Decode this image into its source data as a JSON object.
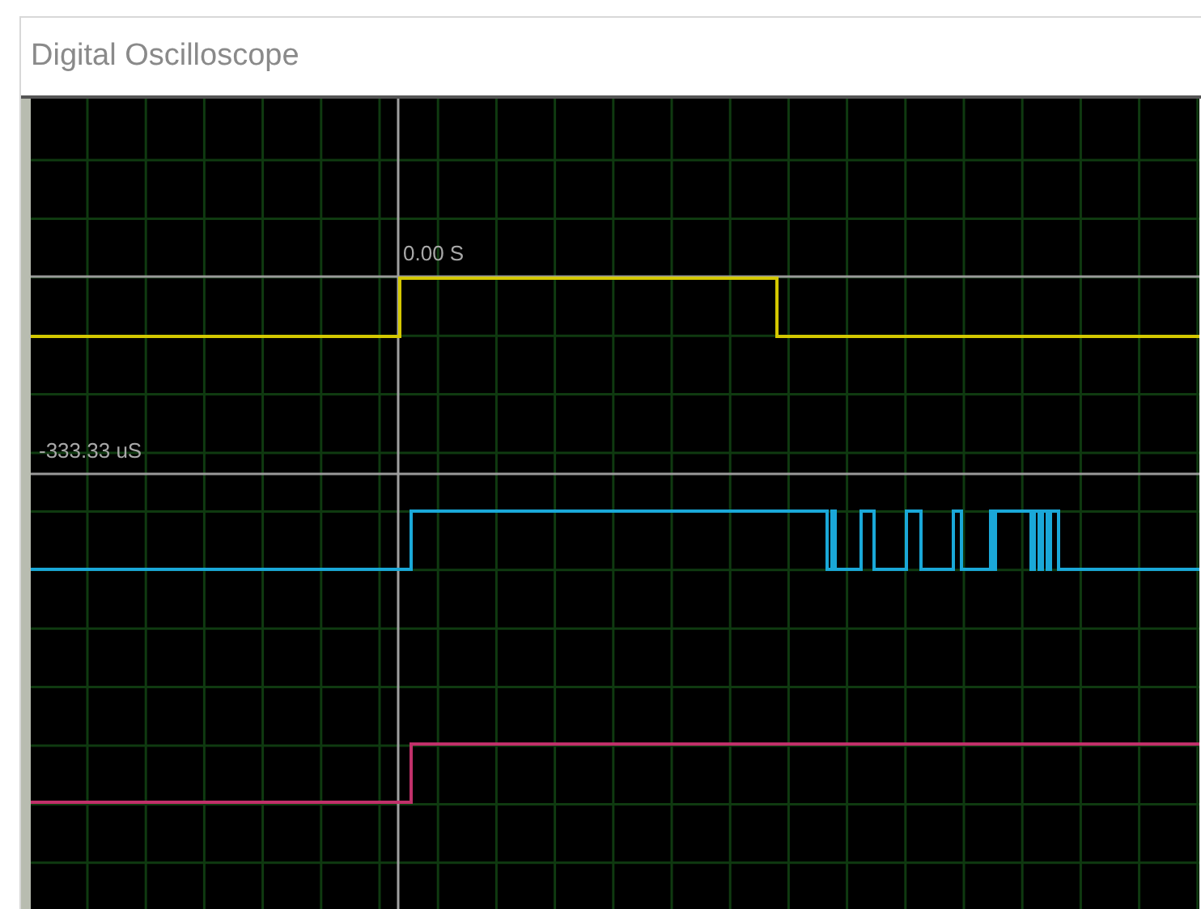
{
  "window": {
    "title": "Digital Oscilloscope"
  },
  "cursor_labels": [
    "0.00 S",
    "-333.33 uS"
  ],
  "traces": [
    {
      "color": "#d4c800"
    },
    {
      "color": "#1aa8d8"
    },
    {
      "color": "#c0306a"
    }
  ]
}
